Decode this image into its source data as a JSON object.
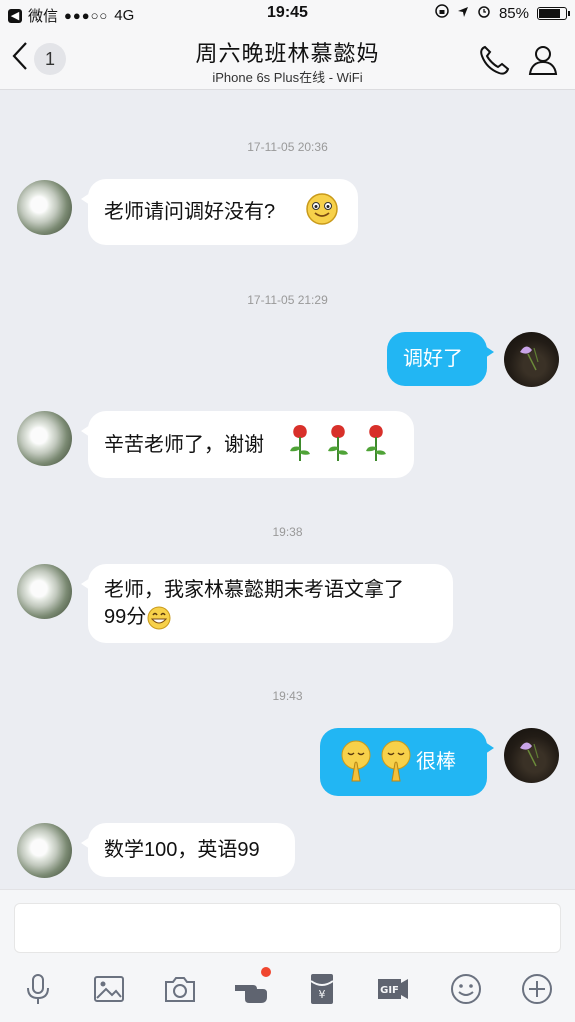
{
  "status_bar": {
    "back_app": "微信",
    "carrier_signal": "●●●○○",
    "network": "4G",
    "time": "19:45",
    "battery": "85%"
  },
  "header": {
    "unread_count": "1",
    "title": "周六晚班林慕懿妈",
    "subtitle": "iPhone 6s Plus在线 - WiFi"
  },
  "messages": [
    {
      "type": "timestamp",
      "text": "17-11-05 20:36"
    },
    {
      "type": "incoming",
      "text": "老师请问调好没有?",
      "emoji": "smile-emoji"
    },
    {
      "type": "timestamp",
      "text": "17-11-05 21:29"
    },
    {
      "type": "outgoing",
      "text": "调好了"
    },
    {
      "type": "incoming",
      "text": "辛苦老师了，谢谢",
      "emoji": "rose-emoji"
    },
    {
      "type": "timestamp",
      "text": "19:38"
    },
    {
      "type": "incoming",
      "line1": "老师，我家林慕懿期末考语文拿了",
      "line2": "99分",
      "emoji": "grin-emoji"
    },
    {
      "type": "timestamp",
      "text": "19:43"
    },
    {
      "type": "outgoing",
      "text": "很棒",
      "emoji": "praying-emoji"
    },
    {
      "type": "incoming",
      "text": "数学100，英语99"
    }
  ],
  "toolbar": [
    "microphone-icon",
    "image-icon",
    "camera-icon",
    "poke-icon",
    "red-packet-icon",
    "gif-icon",
    "emoji-icon",
    "plus-icon"
  ],
  "colors": {
    "outgoing_bubble": "#22b6f3",
    "incoming_bubble": "#ffffff",
    "background": "#ebedf2",
    "badge_dot": "#f0462f"
  }
}
